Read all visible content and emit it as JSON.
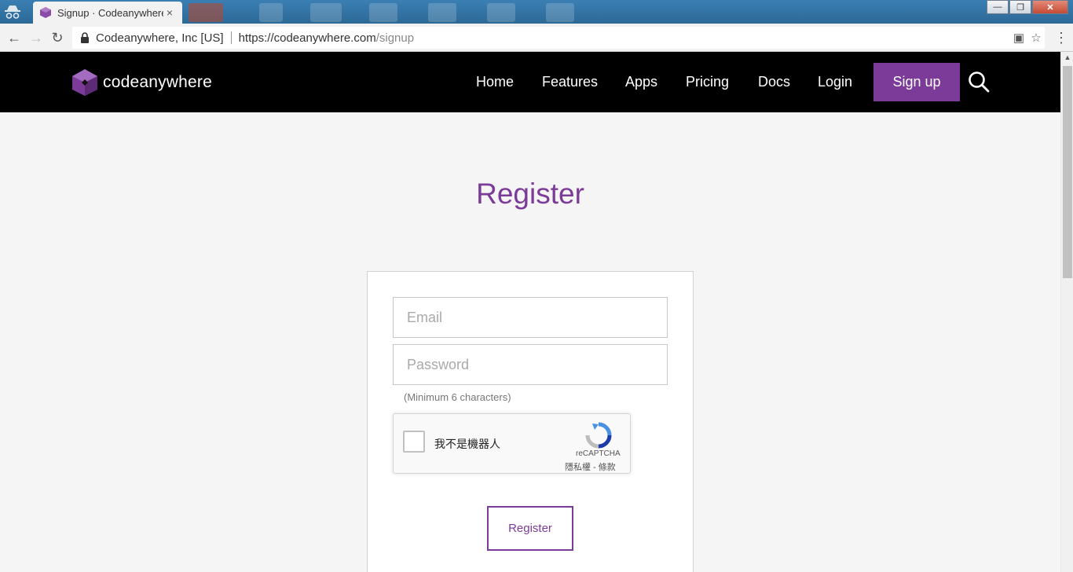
{
  "browser": {
    "tab_title": "Signup · Codeanywhere",
    "tab_close": "×",
    "site_identity": "Codeanywhere, Inc [US]",
    "url_base": "https://codeanywhere.com",
    "url_path": "/signup",
    "window_controls": {
      "minimize": "—",
      "restore": "❐",
      "close": "✕"
    },
    "icons": [
      "incognito-icon",
      "back-icon",
      "forward-icon",
      "reload-icon",
      "lock-icon",
      "translate-icon",
      "star-icon",
      "menu-icon"
    ]
  },
  "header": {
    "logo_text": "codeanywhere",
    "nav": [
      "Home",
      "Features",
      "Apps",
      "Pricing",
      "Docs",
      "Login"
    ],
    "signup_label": "Sign up",
    "accent_color": "#7c3b98"
  },
  "main": {
    "title": "Register",
    "form": {
      "email_placeholder": "Email",
      "password_placeholder": "Password",
      "password_hint": "(Minimum 6 characters)",
      "captcha_label": "我不是機器人",
      "captcha_brand": "reCAPTCHA",
      "captcha_links": "隱私權 - 條款",
      "submit_label": "Register"
    }
  }
}
